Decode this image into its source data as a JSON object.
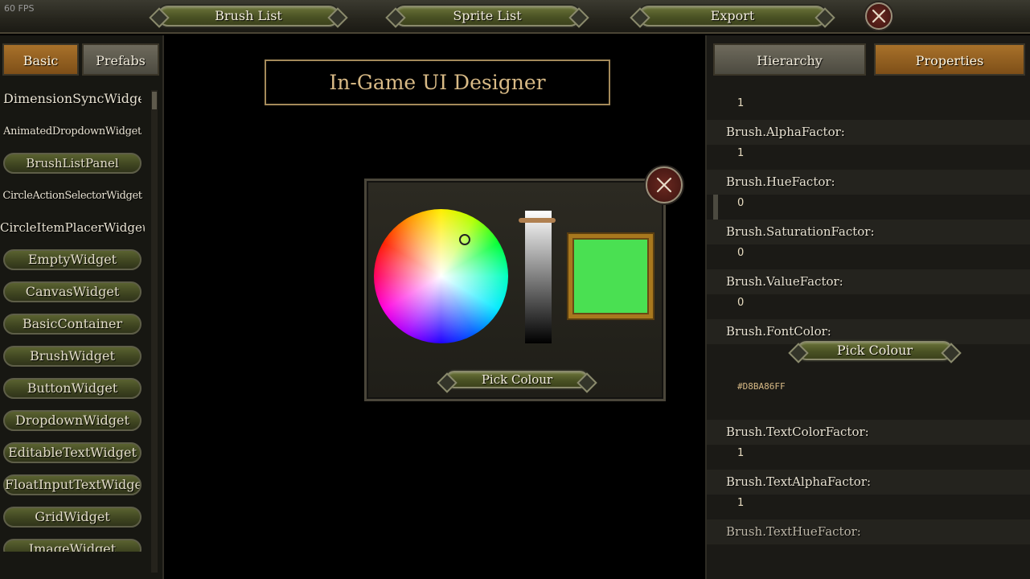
{
  "top_bar": {
    "fps": "60 FPS",
    "brush_list": "Brush List",
    "sprite_list": "Sprite List",
    "export": "Export"
  },
  "left_panel": {
    "tabs": {
      "basic": "Basic",
      "prefabs": "Prefabs"
    },
    "widgets": [
      "DimensionSyncWidget",
      "AnimatedDropdownWidget",
      "BrushListPanel",
      "CircleActionSelectorWidget",
      "CircleItemPlacerWidget",
      "EmptyWidget",
      "CanvasWidget",
      "BasicContainer",
      "BrushWidget",
      "ButtonWidget",
      "DropdownWidget",
      "EditableTextWidget",
      "FloatInputTextWidget",
      "GridWidget",
      "ImageWidget"
    ]
  },
  "title": "In-Game UI Designer",
  "color_picker": {
    "pick_label": "Pick Colour",
    "selected_color": "#4ae052"
  },
  "right_panel": {
    "tabs": {
      "hierarchy": "Hierarchy",
      "properties": "Properties"
    },
    "properties": [
      {
        "value": "1"
      },
      {
        "label": "Brush.AlphaFactor:",
        "value": "1"
      },
      {
        "label": "Brush.HueFactor:",
        "value": "0"
      },
      {
        "label": "Brush.SaturationFactor:",
        "value": "0"
      },
      {
        "label": "Brush.ValueFactor:",
        "value": "0"
      },
      {
        "label": "Brush.FontColor:",
        "button": "Pick Colour",
        "hex": "#D8BA86FF"
      },
      {
        "label": "Brush.TextColorFactor:",
        "value": "1"
      },
      {
        "label": "Brush.TextAlphaFactor:",
        "value": "1"
      },
      {
        "label": "Brush.TextHueFactor:"
      }
    ]
  },
  "colors": {
    "accent_gold": "#d8ba86",
    "tab_active": "#a8712a",
    "button_olive": "#4a5224"
  }
}
